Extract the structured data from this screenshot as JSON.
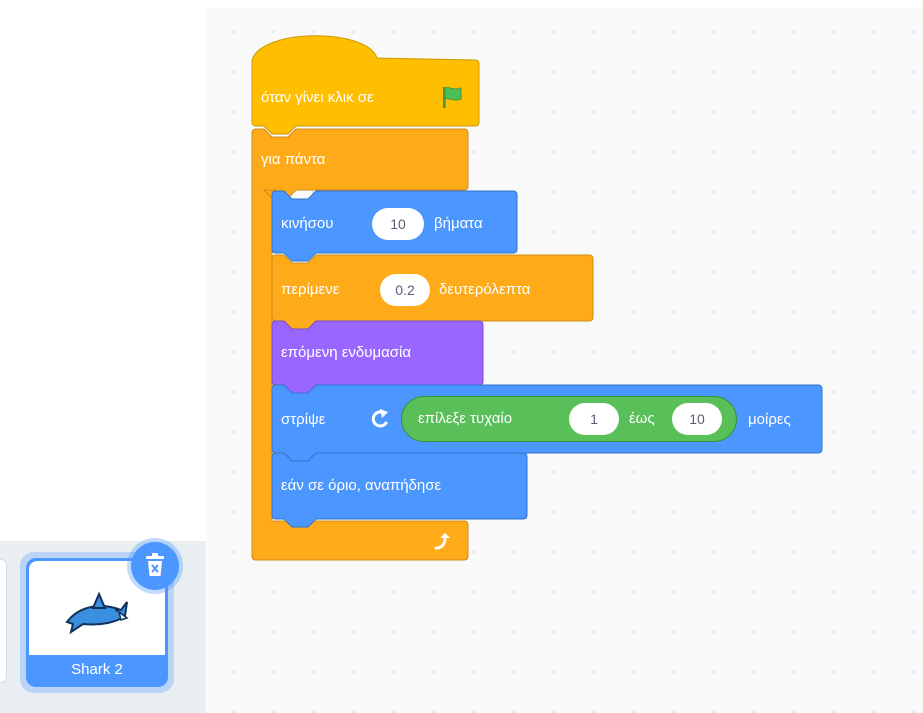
{
  "colors": {
    "events": "#ffbf00",
    "events_border": "#cc9900",
    "control": "#ffab19",
    "control_border": "#cf8b17",
    "motion": "#4c97ff",
    "motion_border": "#3373cc",
    "looks": "#9966ff",
    "looks_border": "#774dcb",
    "operators": "#59c059",
    "operators_border": "#389438",
    "sprite_selected": "#4c97ff",
    "flag": "#4cbf56"
  },
  "script": {
    "hat": {
      "text": "όταν γίνει κλικ σε",
      "icon": "green-flag-icon"
    },
    "forever": {
      "text": "για πάντα",
      "icon": "loop-arrow-icon"
    },
    "move": {
      "text": "κινήσου",
      "value": "10",
      "unit": "βήματα"
    },
    "wait": {
      "text": "περίμενε",
      "value": "0.2",
      "unit": "δευτερόλεπτα"
    },
    "next_costume": {
      "text": "επόμενη ενδυμασία"
    },
    "turn": {
      "text": "στρίψε",
      "icon": "rotate-right-icon",
      "unit": "μοίρες",
      "random": {
        "text": "επίλεξε τυχαίο",
        "from": "1",
        "to_word": "έως",
        "to": "10"
      }
    },
    "bounce": {
      "text": "εάν σε όριο, αναπήδησε"
    }
  },
  "sprite": {
    "name": "Shark 2",
    "delete_icon": "trash-icon",
    "thumbnail_icon": "shark-icon"
  }
}
